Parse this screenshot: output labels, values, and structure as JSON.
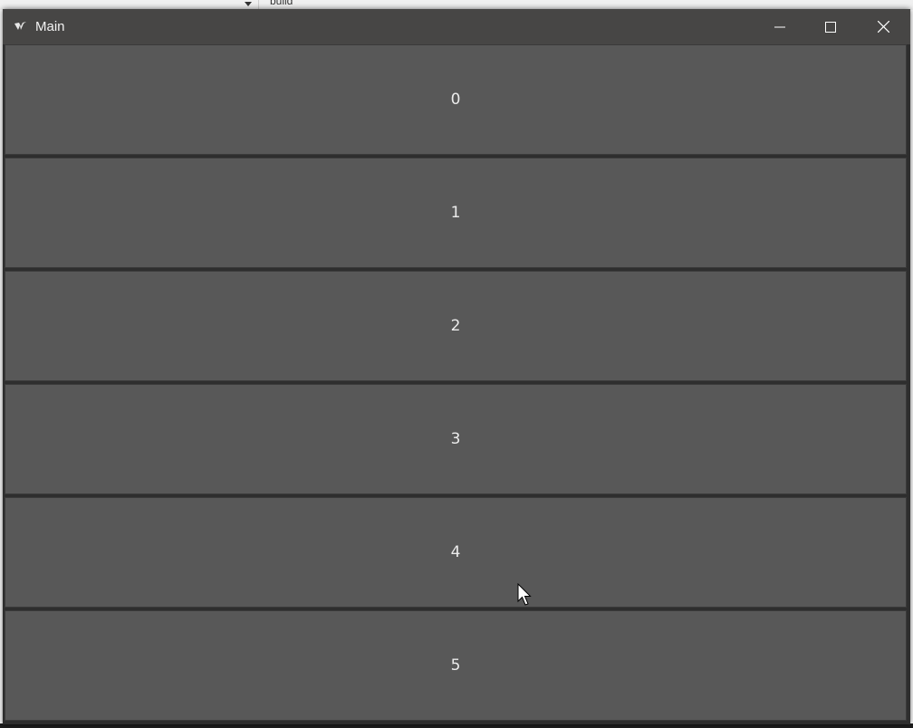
{
  "window": {
    "title": "Main",
    "controls": {
      "minimize": "minimize",
      "maximize": "maximize",
      "close": "close"
    }
  },
  "background": {
    "folder_label": "build"
  },
  "buttons": [
    {
      "label": "0"
    },
    {
      "label": "1"
    },
    {
      "label": "2"
    },
    {
      "label": "3"
    },
    {
      "label": "4"
    },
    {
      "label": "5"
    }
  ],
  "colors": {
    "titlebar": "#474645",
    "button_bg": "#585858",
    "button_text": "#ececec"
  },
  "icons": {
    "app": "kivy-icon",
    "minimize": "minimize-icon",
    "maximize": "maximize-icon",
    "close": "close-icon",
    "cursor": "mouse-cursor-icon"
  }
}
